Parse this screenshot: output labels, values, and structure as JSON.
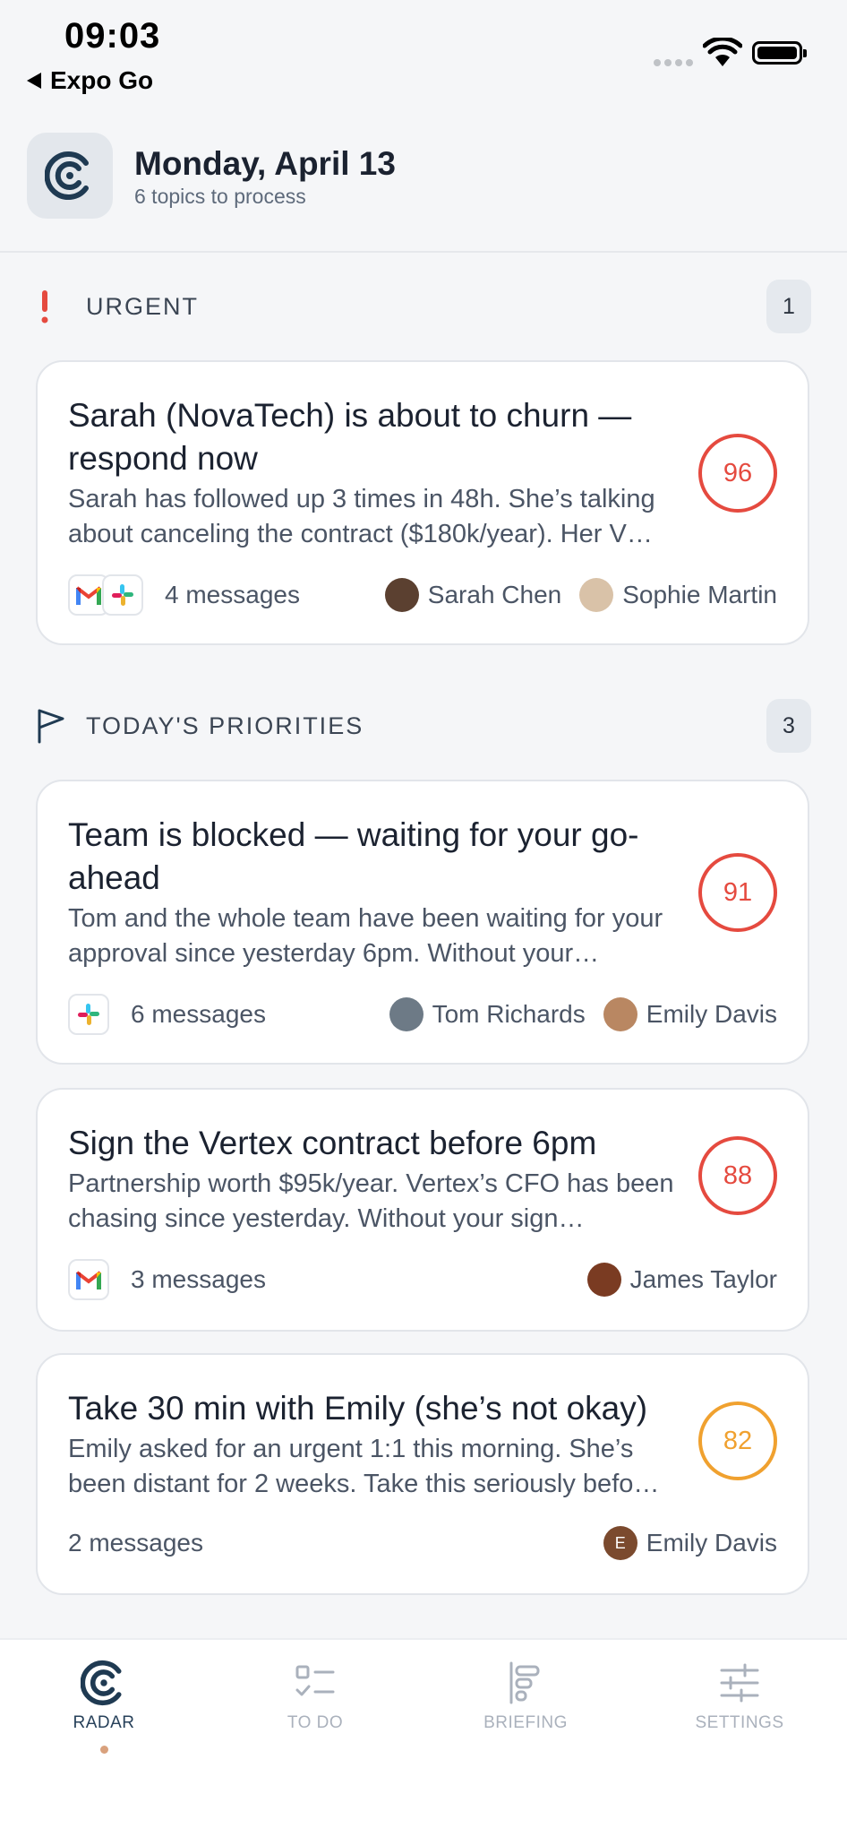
{
  "status_bar": {
    "time": "09:03",
    "back_label": "Expo Go"
  },
  "header": {
    "title": "Monday, April 13",
    "subtitle": "6 topics to process"
  },
  "sections": {
    "urgent": {
      "label": "URGENT",
      "count": "1"
    },
    "priorities": {
      "label": "TODAY'S PRIORITIES",
      "count": "3"
    }
  },
  "cards": [
    {
      "title": "Sarah (NovaTech) is about to churn — respond now",
      "description": "Sarah has followed up 3 times in 48h. She’s talking about canceling the contract ($180k/year). Her V…",
      "score": "96",
      "score_color": "#e54a3f",
      "apps": [
        "gmail-icon",
        "slack-icon"
      ],
      "messages": "4 messages",
      "people": [
        {
          "name": "Sarah Chen",
          "avatar_color": "#5b4030"
        },
        {
          "name": "Sophie Martin",
          "avatar_color": "#d9c2a8"
        }
      ]
    },
    {
      "title": "Team is blocked — waiting for your go-ahead",
      "description": "Tom and the whole team have been waiting for your approval since yesterday 6pm. Without your…",
      "score": "91",
      "score_color": "#e54a3f",
      "apps": [
        "slack-icon"
      ],
      "messages": "6 messages",
      "people": [
        {
          "name": "Tom Richards",
          "avatar_color": "#6d7a86"
        },
        {
          "name": "Emily Davis",
          "avatar_color": "#b98762"
        }
      ]
    },
    {
      "title": "Sign the Vertex contract before 6pm",
      "description": "Partnership worth $95k/year. Vertex’s CFO has been chasing since yesterday. Without your sign…",
      "score": "88",
      "score_color": "#e54a3f",
      "apps": [
        "gmail-icon"
      ],
      "messages": "3 messages",
      "people": [
        {
          "name": "James Taylor",
          "avatar_color": "#7a3b22"
        }
      ]
    },
    {
      "title": "Take 30 min with Emily (she’s not okay)",
      "description": "Emily asked for an urgent 1:1 this morning. She’s been distant for 2 weeks. Take this seriously befo…",
      "score": "82",
      "score_color": "#f0a12f",
      "apps": [],
      "messages": "2 messages",
      "people": [
        {
          "name": "Emily Davis",
          "avatar_color": "#7b4a2e",
          "initial": "E"
        }
      ]
    }
  ],
  "tabs": [
    {
      "label": "RADAR",
      "icon": "radar-icon",
      "active": true
    },
    {
      "label": "TO DO",
      "icon": "todo-icon",
      "active": false
    },
    {
      "label": "BRIEFING",
      "icon": "briefing-icon",
      "active": false
    },
    {
      "label": "SETTINGS",
      "icon": "settings-sliders-icon",
      "active": false
    }
  ]
}
